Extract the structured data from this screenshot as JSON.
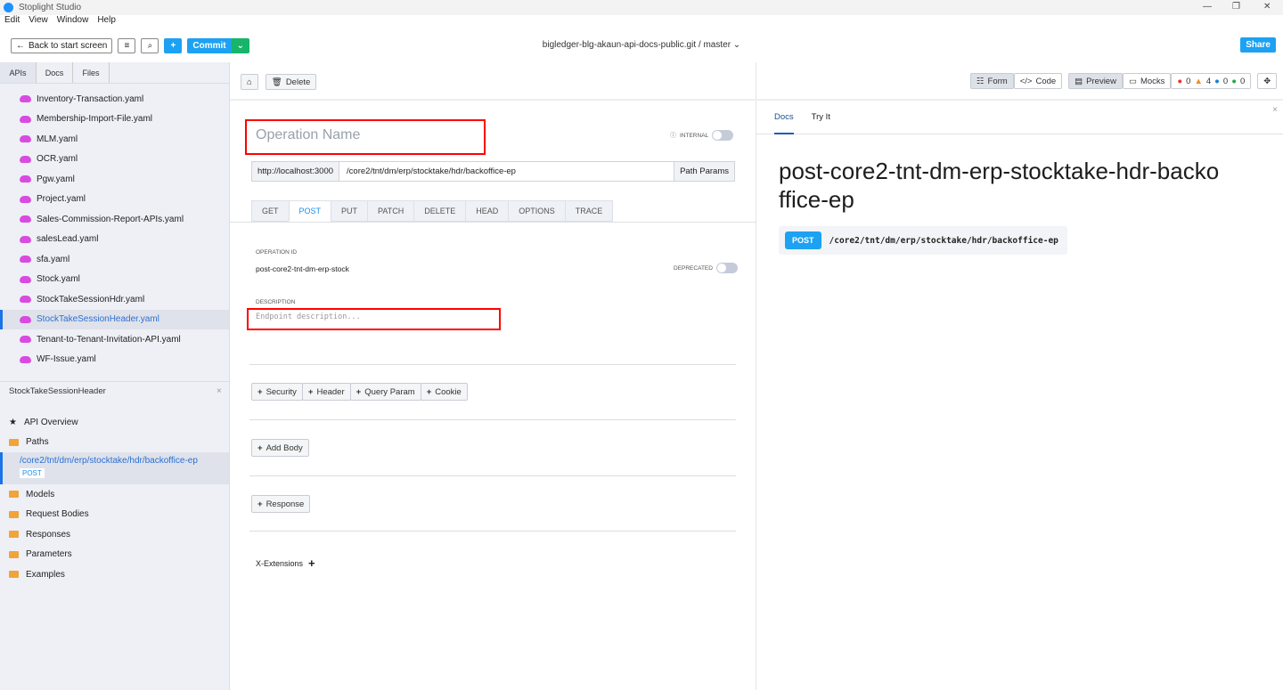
{
  "app": {
    "title": "Stoplight Studio",
    "menu": [
      "Edit",
      "View",
      "Window",
      "Help"
    ]
  },
  "toolbar": {
    "back": "Back to start screen",
    "commit": "Commit",
    "repo": "bigledger-blg-akaun-api-docs-public.git",
    "branch": "master",
    "share": "Share"
  },
  "sidebar": {
    "tabs": [
      "APIs",
      "Docs",
      "Files"
    ],
    "files": [
      "Inventory-Transaction.yaml",
      "Membership-Import-File.yaml",
      "MLM.yaml",
      "OCR.yaml",
      "Pgw.yaml",
      "Project.yaml",
      "Sales-Commission-Report-APIs.yaml",
      "salesLead.yaml",
      "sfa.yaml",
      "Stock.yaml",
      "StockTakeSessionHdr.yaml",
      "StockTakeSessionHeader.yaml",
      "Tenant-to-Tenant-Invitation-API.yaml",
      "WF-Issue.yaml"
    ],
    "selected_file": "StockTakeSessionHeader.yaml",
    "tree_title": "StockTakeSessionHeader",
    "overview": "API Overview",
    "paths": "Paths",
    "path_item": "/core2/tnt/dm/erp/stocktake/hdr/backoffice-ep",
    "path_method": "POST",
    "groups": [
      "Models",
      "Request Bodies",
      "Responses",
      "Parameters",
      "Examples"
    ]
  },
  "editor": {
    "delete": "Delete",
    "form": "Form",
    "code": "Code",
    "preview": "Preview",
    "mocks": "Mocks",
    "counts": {
      "errors": "0",
      "warnings": "4",
      "info": "0",
      "hints": "0"
    },
    "op_name_placeholder": "Operation Name",
    "internal": "INTERNAL",
    "server": "http://localhost:3000",
    "path": "/core2/tnt/dm/erp/stocktake/hdr/backoffice-ep",
    "path_params": "Path Params",
    "methods": [
      "GET",
      "POST",
      "PUT",
      "PATCH",
      "DELETE",
      "HEAD",
      "OPTIONS",
      "TRACE"
    ],
    "active_method": "POST",
    "op_id_label": "OPERATION ID",
    "op_id": "post-core2-tnt-dm-erp-stock",
    "deprecated": "DEPRECATED",
    "desc_label": "DESCRIPTION",
    "desc_placeholder": "Endpoint description...",
    "params": [
      "Security",
      "Header",
      "Query Param",
      "Cookie"
    ],
    "add_body": "Add Body",
    "response": "Response",
    "x_ext": "X-Extensions"
  },
  "preview": {
    "tabs": [
      "Docs",
      "Try It"
    ],
    "title": "post-core2-tnt-dm-erp-stocktake-hdr-backoffice-ep",
    "method": "POST",
    "path": "/core2/tnt/dm/erp/stocktake/hdr/backoffice-ep"
  }
}
